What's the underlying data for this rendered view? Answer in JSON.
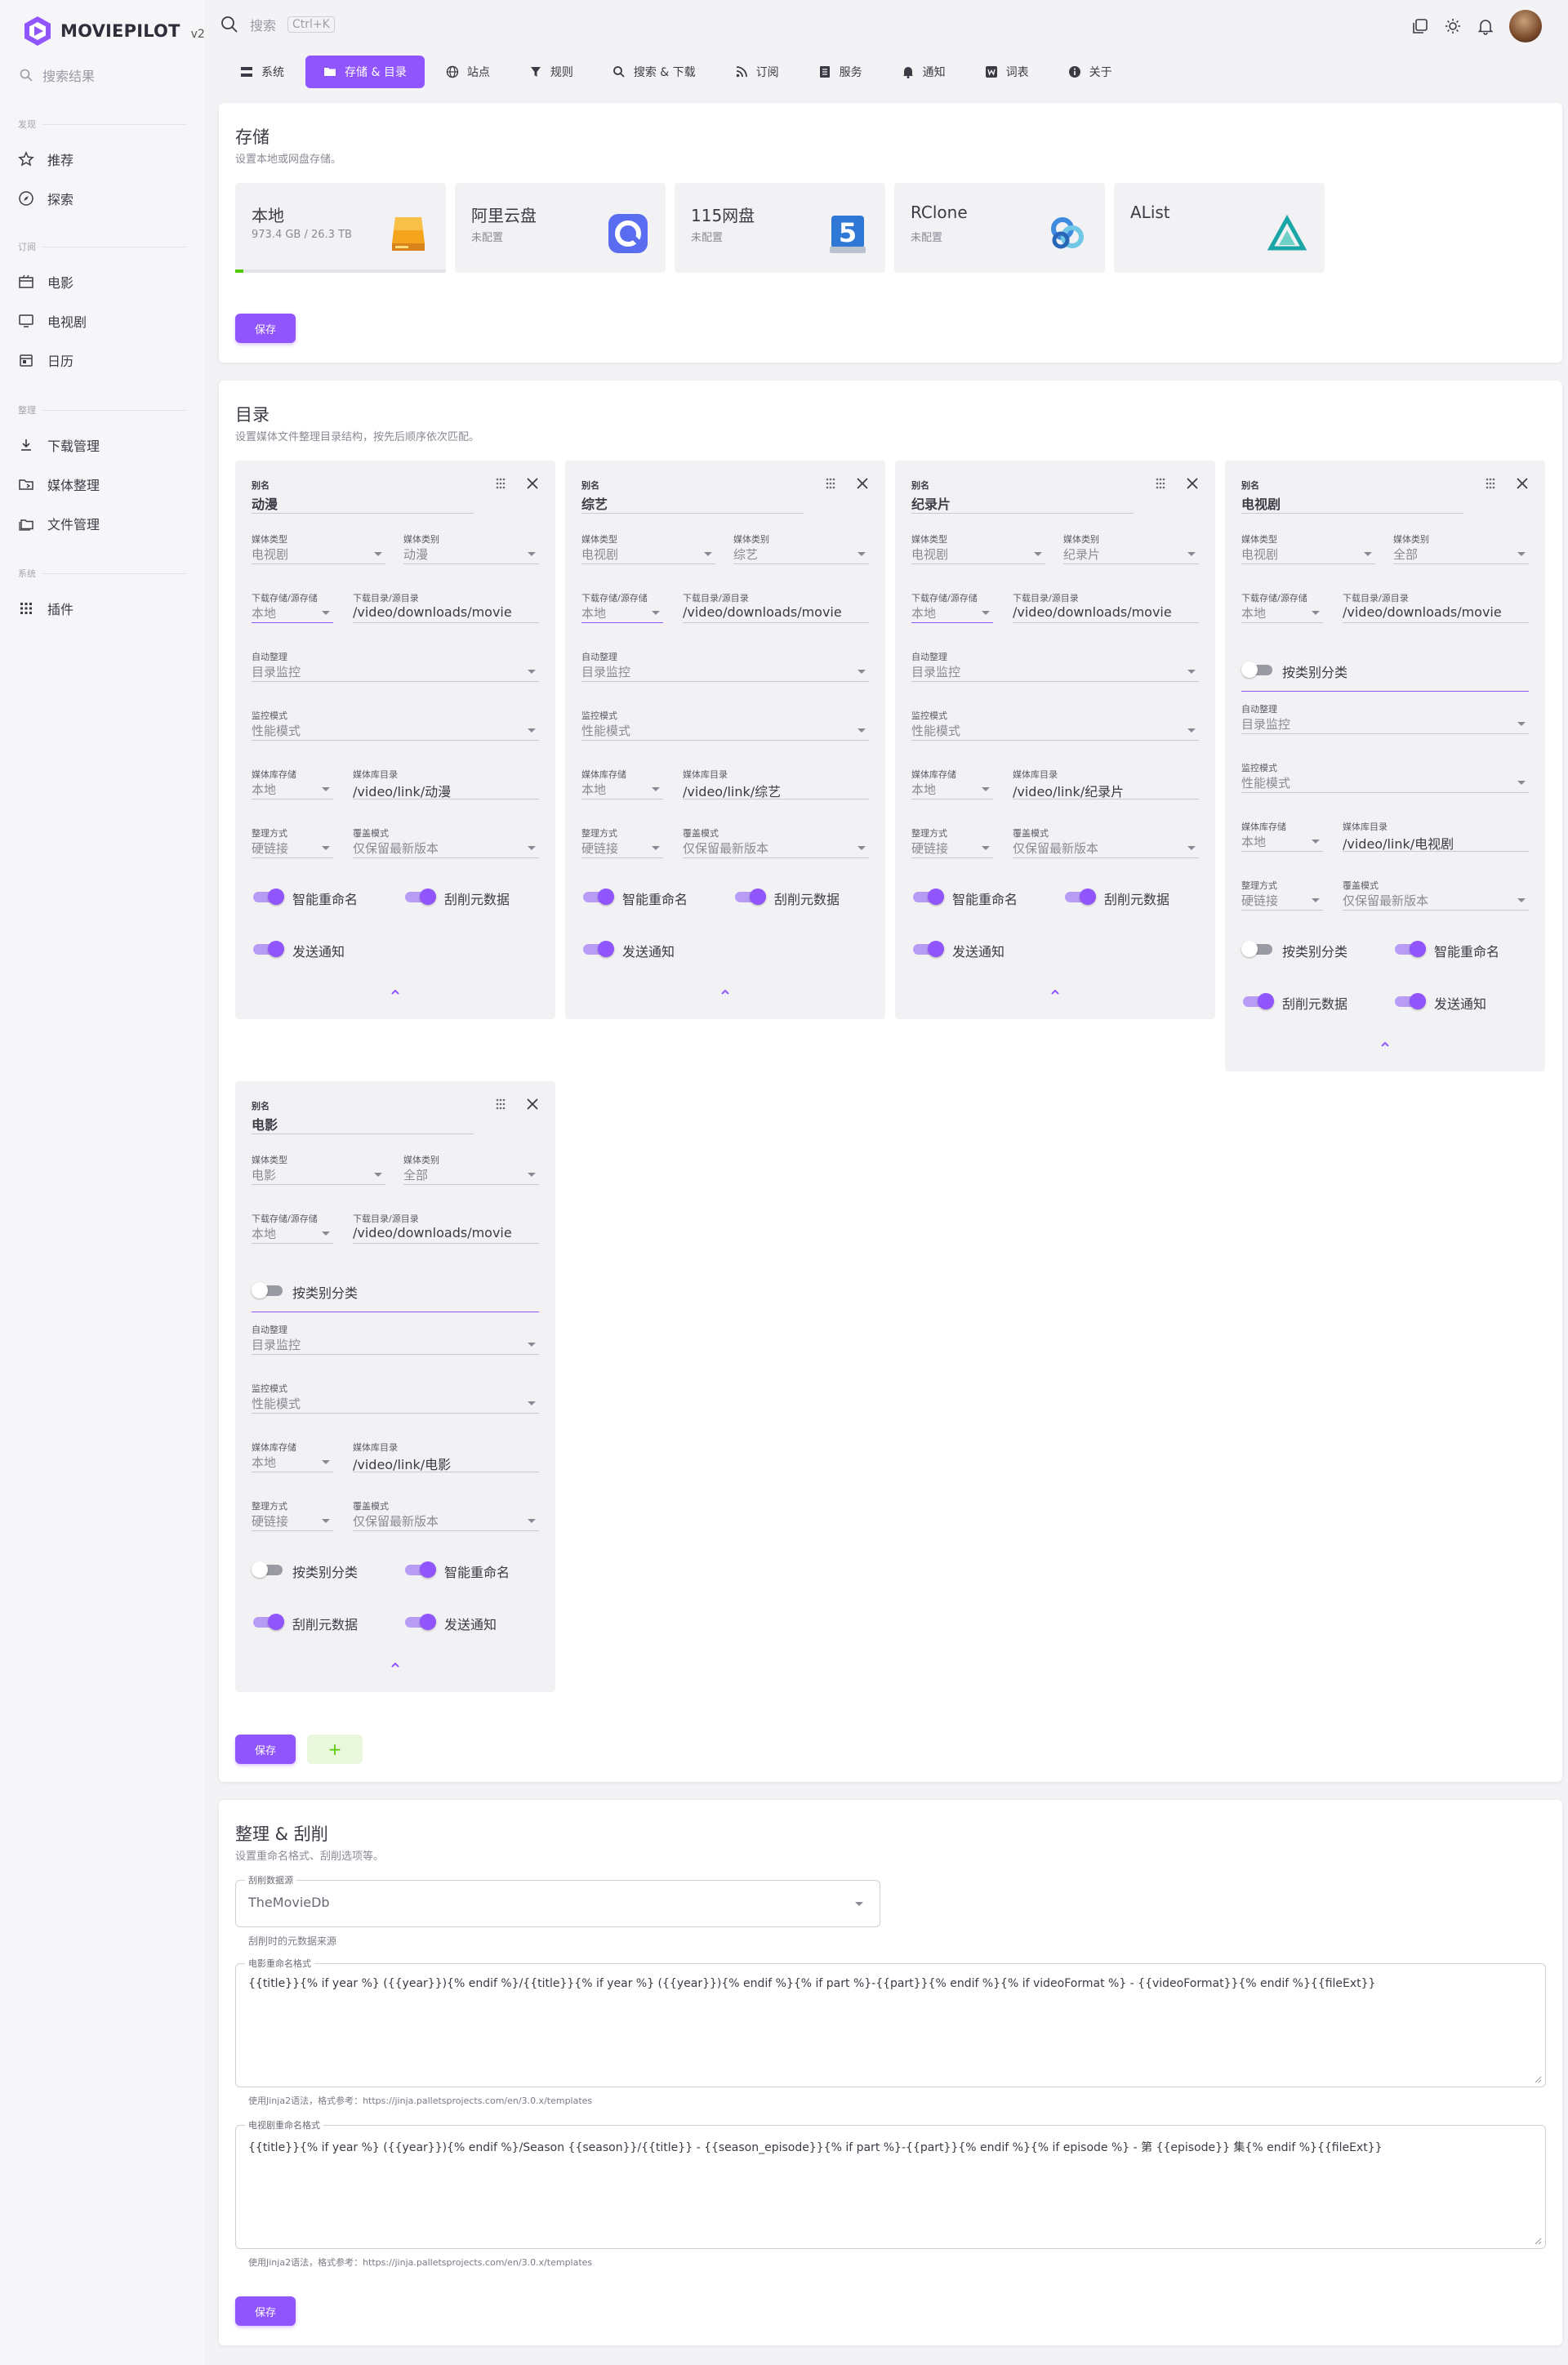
{
  "app": {
    "logo_text": "MOVIEPILOT",
    "version": "v2",
    "search_placeholder": "搜索结果"
  },
  "topbar": {
    "search_placeholder": "搜索",
    "shortcut": "Ctrl+K"
  },
  "sidebar": {
    "sections": [
      "发现",
      "订阅",
      "整理",
      "系统"
    ],
    "items": [
      "推荐",
      "探索",
      "电影",
      "电视剧",
      "日历",
      "下载管理",
      "媒体整理",
      "文件管理",
      "插件"
    ]
  },
  "tabs": [
    "系统",
    "存储 & 目录",
    "站点",
    "规则",
    "搜索 & 下载",
    "订阅",
    "服务",
    "通知",
    "词表",
    "关于"
  ],
  "storage": {
    "title": "存储",
    "subtitle": "设置本地或网盘存储。",
    "save": "保存",
    "items": [
      {
        "name": "本地",
        "status": "973.4 GB / 26.3 TB",
        "usage": 0.04
      },
      {
        "name": "阿里云盘",
        "status": "未配置"
      },
      {
        "name": "115网盘",
        "status": "未配置"
      },
      {
        "name": "RClone",
        "status": "未配置"
      },
      {
        "name": "AList",
        "status": ""
      }
    ]
  },
  "directory": {
    "title": "目录",
    "subtitle": "设置媒体文件整理目录结构，按先后顺序依次匹配。",
    "save": "保存",
    "add": "+",
    "labels": {
      "alias": "别名",
      "media_type": "媒体类型",
      "media_category": "媒体类别",
      "download_storage": "下载存储/源存储",
      "download_path": "下载目录/源目录",
      "auto_organize": "自动整理",
      "monitor_mode": "监控模式",
      "library_storage": "媒体库存储",
      "library_path": "媒体库目录",
      "transfer_type": "整理方式",
      "overwrite_mode": "覆盖模式",
      "by_category": "按类别分类",
      "smart_rename": "智能重命名",
      "scrape": "刮削元数据",
      "notify": "发送通知"
    },
    "cards": [
      {
        "alias": "动漫",
        "media_type": "电视剧",
        "media_category": "动漫",
        "download_storage": "本地",
        "download_path": "/video/downloads/movie",
        "auto_organize": "目录监控",
        "monitor_mode": "性能模式",
        "library_storage": "本地",
        "library_path": "/video/link/动漫",
        "transfer_type": "硬链接",
        "overwrite_mode": "仅保留最新版本"
      },
      {
        "alias": "综艺",
        "media_type": "电视剧",
        "media_category": "综艺",
        "download_storage": "本地",
        "download_path": "/video/downloads/movie",
        "auto_organize": "目录监控",
        "monitor_mode": "性能模式",
        "library_storage": "本地",
        "library_path": "/video/link/综艺",
        "transfer_type": "硬链接",
        "overwrite_mode": "仅保留最新版本"
      },
      {
        "alias": "纪录片",
        "media_type": "电视剧",
        "media_category": "纪录片",
        "download_storage": "本地",
        "download_path": "/video/downloads/movie",
        "auto_organize": "目录监控",
        "monitor_mode": "性能模式",
        "library_storage": "本地",
        "library_path": "/video/link/纪录片",
        "transfer_type": "硬链接",
        "overwrite_mode": "仅保留最新版本"
      },
      {
        "alias": "电视剧",
        "media_type": "电视剧",
        "media_category": "全部",
        "download_storage": "本地",
        "download_path": "/video/downloads/movie",
        "auto_organize": "目录监控",
        "monitor_mode": "性能模式",
        "library_storage": "本地",
        "library_path": "/video/link/电视剧",
        "transfer_type": "硬链接",
        "overwrite_mode": "仅保留最新版本"
      },
      {
        "alias": "电影",
        "media_type": "电影",
        "media_category": "全部",
        "download_storage": "本地",
        "download_path": "/video/downloads/movie",
        "auto_organize": "目录监控",
        "monitor_mode": "性能模式",
        "library_storage": "本地",
        "library_path": "/video/link/电影",
        "transfer_type": "硬链接",
        "overwrite_mode": "仅保留最新版本"
      }
    ]
  },
  "scrape": {
    "title": "整理 & 刮削",
    "subtitle": "设置重命名格式、刮削选项等。",
    "source_label": "刮削数据源",
    "source_value": "TheMovieDb",
    "source_hint": "刮削时的元数据来源",
    "movie_label": "电影重命名格式",
    "movie_format": "{{title}}{% if year %} ({{year}}){% endif %}/{{title}}{% if year %} ({{year}}){% endif %}{% if part %}-{{part}}{% endif %}{% if videoFormat %} - {{videoFormat}}{% endif %}{{fileExt}}",
    "tv_label": "电视剧重命名格式",
    "tv_format": "{{title}}{% if year %} ({{year}}){% endif %}/Season {{season}}/{{title}} - {{season_episode}}{% if part %}-{{part}}{% endif %}{% if episode %} - 第 {{episode}} 集{% endif %}{{fileExt}}",
    "hint": "使用Jinja2语法，格式参考：https://jinja.palletsprojects.com/en/3.0.x/templates",
    "save": "保存"
  },
  "colors": {
    "primary": "#9155fd",
    "success": "#56ca00"
  }
}
